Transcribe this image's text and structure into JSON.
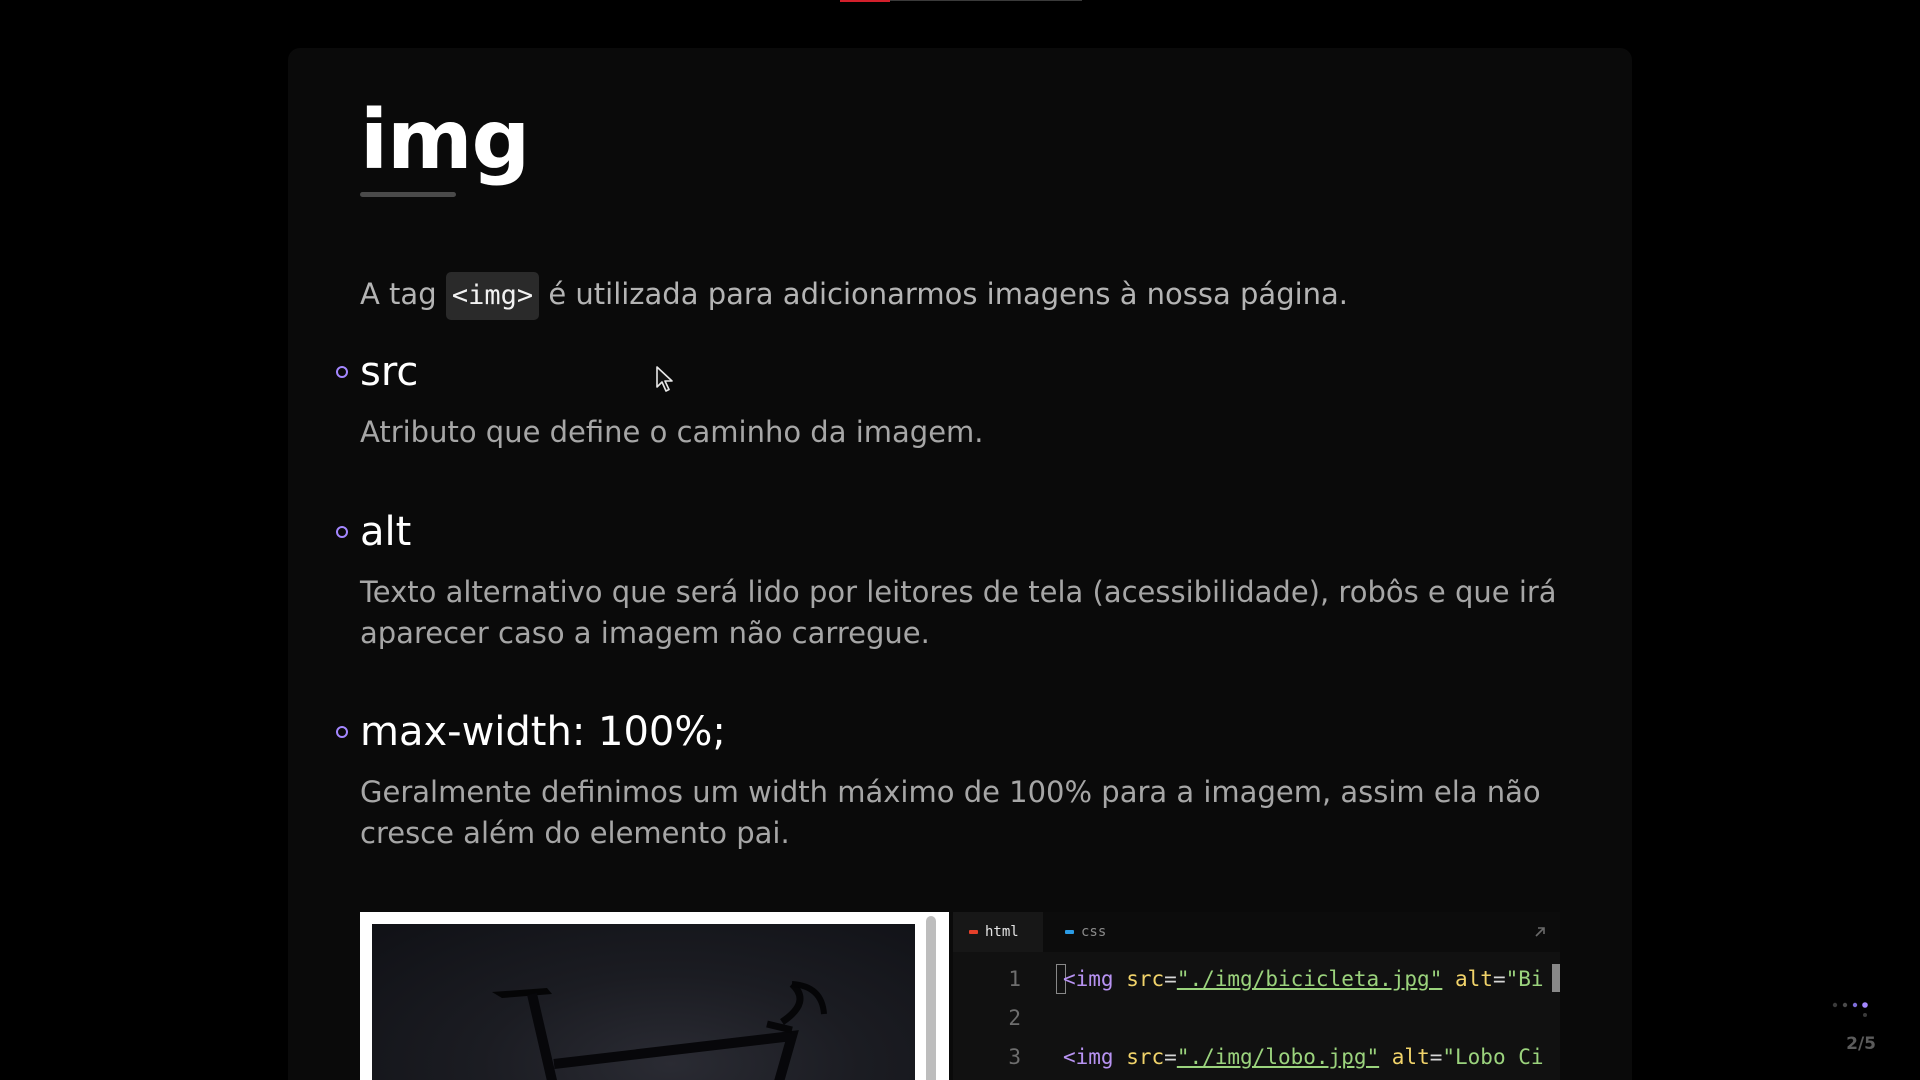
{
  "slide": {
    "title": "img",
    "intro": {
      "before": "A tag ",
      "code": "<img>",
      "after": " é utilizada para adicionarmos imagens à nossa página."
    },
    "attributes": [
      {
        "name": "src",
        "description": "Atributo que define o caminho da imagem."
      },
      {
        "name": "alt",
        "description": "Texto alternativo que será lido por leitores de tela (acessibilidade), robôs e que irá aparecer caso a imagem não carregue."
      },
      {
        "name": "max-width: 100%;",
        "description": "Geralmente definimos um width máximo de 100% para a imagem, assim ela não cresce além do elemento pai."
      }
    ]
  },
  "editor": {
    "tabs": [
      {
        "label": "html",
        "color": "#e5402a"
      },
      {
        "label": "css",
        "color": "#2b9ce6"
      }
    ],
    "lines": [
      {
        "number": "1",
        "tag_open": "<img",
        "attr1": "src",
        "eq1": "=",
        "str1": "\"./img/bicicleta.jpg\"",
        "attr2": "alt",
        "eq2": "=",
        "str2": "\"Bi"
      },
      {
        "number": "2"
      },
      {
        "number": "3",
        "tag_open": "<img",
        "attr1": "src",
        "eq1": "=",
        "str1": "\"./img/lobo.jpg\"",
        "attr2": "alt",
        "eq2": "=",
        "str2": "\"Lobo Ci"
      }
    ]
  },
  "navigation": {
    "page_indicator": "2/5"
  },
  "colors": {
    "background": "#000000",
    "slide_background": "#0a0a0a",
    "bullet_accent": "#a487ff",
    "html_tab_accent": "#e5402a",
    "css_tab_accent": "#2b9ce6",
    "top_progress": "#d21f2b"
  },
  "icons": {
    "bullet": "circle-bullet-icon",
    "expand": "expand-arrow-icon",
    "cursor": "mouse-pointer-icon",
    "navigation": "navigation-dots-icon"
  }
}
